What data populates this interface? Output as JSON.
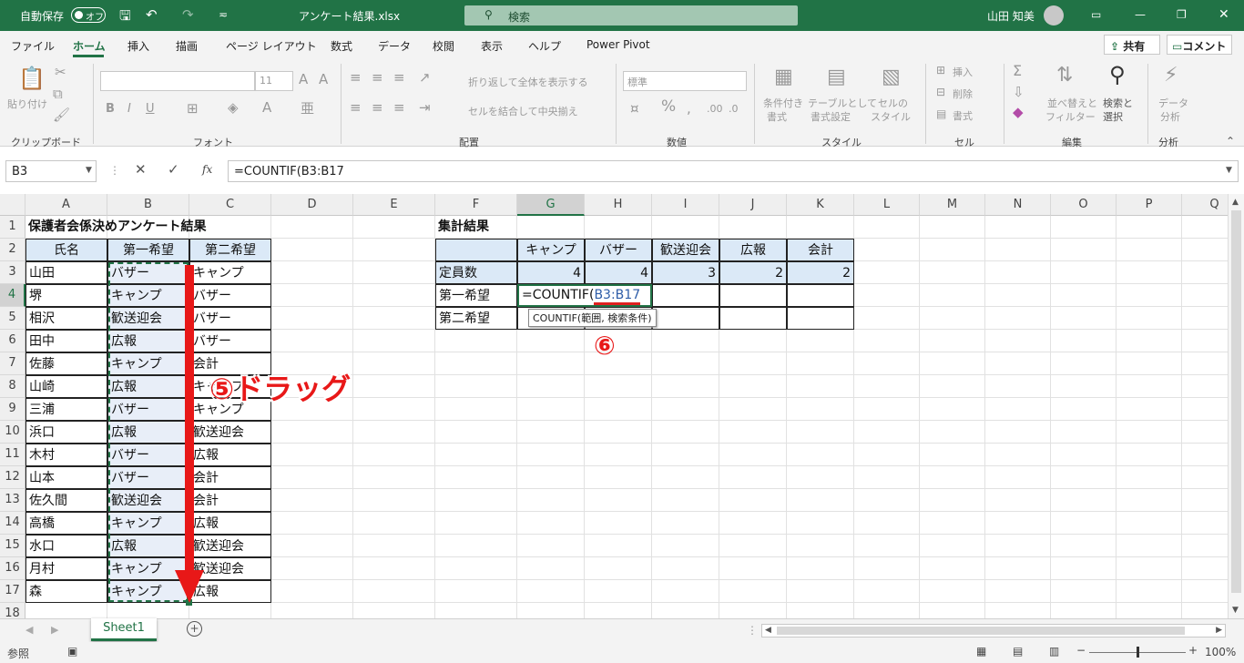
{
  "titlebar": {
    "autosave": "自動保存",
    "toggle": "オフ",
    "filename": "アンケート結果.xlsx",
    "search": "検索",
    "user": "山田 知美"
  },
  "tabs": [
    "ファイル",
    "ホーム",
    "挿入",
    "描画",
    "ページ レイアウト",
    "数式",
    "データ",
    "校閲",
    "表示",
    "ヘルプ",
    "Power Pivot"
  ],
  "share": "共有",
  "comment": "コメント",
  "ribbon": {
    "paste": "貼り付け",
    "clipboard": "クリップボード",
    "font": "フォント",
    "fontsize": "11",
    "bold": "B",
    "italic": "I",
    "underline": "U",
    "wrap": "折り返して全体を表示する",
    "merge": "セルを結合して中央揃え",
    "alignment": "配置",
    "numfmt": "標準",
    "number": "数値",
    "cond1": "条件付き",
    "cond2": "書式",
    "tbl1": "テーブルとして",
    "tbl2": "書式設定",
    "cs1": "セルの",
    "cs2": "スタイル",
    "styles": "スタイル",
    "ins": "挿入",
    "del": "削除",
    "fmt": "書式",
    "cells": "セル",
    "sort1": "並べ替えと",
    "sort2": "フィルター",
    "find1": "検索と",
    "find2": "選択",
    "editing": "編集",
    "an1": "データ",
    "an2": "分析",
    "analysis": "分析"
  },
  "namebox": "B3",
  "fx": "fx",
  "formula": "=COUNTIF(B3:B17",
  "columns": [
    "A",
    "B",
    "C",
    "D",
    "E",
    "F",
    "G",
    "H",
    "I",
    "J",
    "K",
    "L",
    "M",
    "N",
    "O",
    "P",
    "Q"
  ],
  "rows": [
    "1",
    "2",
    "3",
    "4",
    "5",
    "6",
    "7",
    "8",
    "9",
    "10",
    "11",
    "12",
    "13",
    "14",
    "15",
    "16",
    "17",
    "18"
  ],
  "table_title": "保護者会係決めアンケート結果",
  "headers": [
    "氏名",
    "第一希望",
    "第二希望"
  ],
  "data": [
    [
      "山田",
      "バザー",
      "キャンプ"
    ],
    [
      "堺",
      "キャンプ",
      "バザー"
    ],
    [
      "相沢",
      "歓送迎会",
      "バザー"
    ],
    [
      "田中",
      "広報",
      "バザー"
    ],
    [
      "佐藤",
      "キャンプ",
      "会計"
    ],
    [
      "山崎",
      "広報",
      "キャンプ"
    ],
    [
      "三浦",
      "バザー",
      "キャンプ"
    ],
    [
      "浜口",
      "広報",
      "歓送迎会"
    ],
    [
      "木村",
      "バザー",
      "広報"
    ],
    [
      "山本",
      "バザー",
      "会計"
    ],
    [
      "佐久間",
      "歓送迎会",
      "会計"
    ],
    [
      "高橋",
      "キャンプ",
      "広報"
    ],
    [
      "水口",
      "広報",
      "歓送迎会"
    ],
    [
      "月村",
      "キャンプ",
      "歓送迎会"
    ],
    [
      "森",
      "キャンプ",
      "広報"
    ]
  ],
  "summary": {
    "title": "集計結果",
    "headers": [
      "キャンプ",
      "バザー",
      "歓送迎会",
      "広報",
      "会計"
    ],
    "row_labels": [
      "定員数",
      "第一希望",
      "第二希望"
    ],
    "capacity": [
      "4",
      "4",
      "3",
      "2",
      "2"
    ],
    "formula_prefix": "=COUNTIF(",
    "formula_ref": "B3:B17",
    "tooltip": "COUNTIF(範囲, 検索条件)"
  },
  "annotations": {
    "drag": "⑤ドラッグ",
    "step6": "⑥"
  },
  "sheet": "Sheet1",
  "status": {
    "mode": "参照",
    "zoom": "100%"
  }
}
